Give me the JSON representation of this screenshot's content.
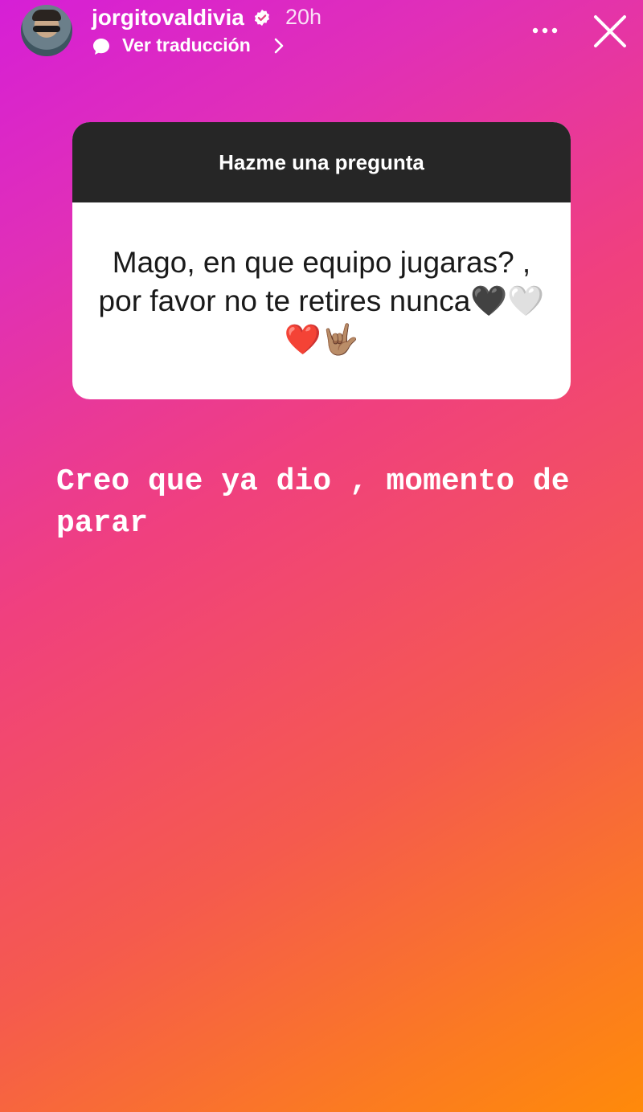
{
  "story_header": {
    "username": "jorgitovaldivia",
    "time_ago": "20h",
    "translate_label": "Ver traducción"
  },
  "question_sticker": {
    "header": "Hazme una pregunta",
    "question": "Mago, en que equipo jugaras? , por favor no te retires nunca🖤🤍❤️🤟🏽"
  },
  "answer_text": "Creo que ya dio , momento de parar",
  "colors": {
    "gradient_start": "#d61fd6",
    "gradient_end": "#ff8a0a",
    "sticker_header_bg": "#262626"
  }
}
